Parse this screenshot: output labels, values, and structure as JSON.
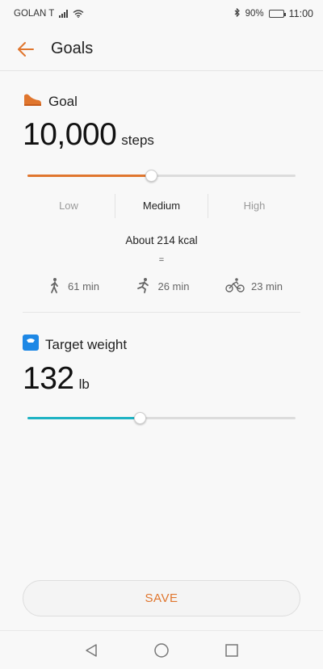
{
  "status_bar": {
    "carrier": "GOLAN T",
    "battery": "90%",
    "time": "11:00"
  },
  "header": {
    "title": "Goals"
  },
  "goal": {
    "label": "Goal",
    "value": "10,000",
    "unit": "steps",
    "slider_fraction": 0.46,
    "levels": [
      "Low",
      "Medium",
      "High"
    ],
    "selected_level": "Medium",
    "kcal": "About 214 kcal",
    "equals": "=",
    "activities": [
      {
        "icon": "walk-icon",
        "label": "61 min"
      },
      {
        "icon": "run-icon",
        "label": "26 min"
      },
      {
        "icon": "bike-icon",
        "label": "23 min"
      }
    ]
  },
  "target_weight": {
    "label": "Target weight",
    "value": "132",
    "unit": "lb",
    "slider_fraction": 0.42
  },
  "save_label": "SAVE",
  "colors": {
    "accent_orange": "#e0762e",
    "accent_teal": "#1fb3c4",
    "scale_blue": "#1e88e5"
  }
}
